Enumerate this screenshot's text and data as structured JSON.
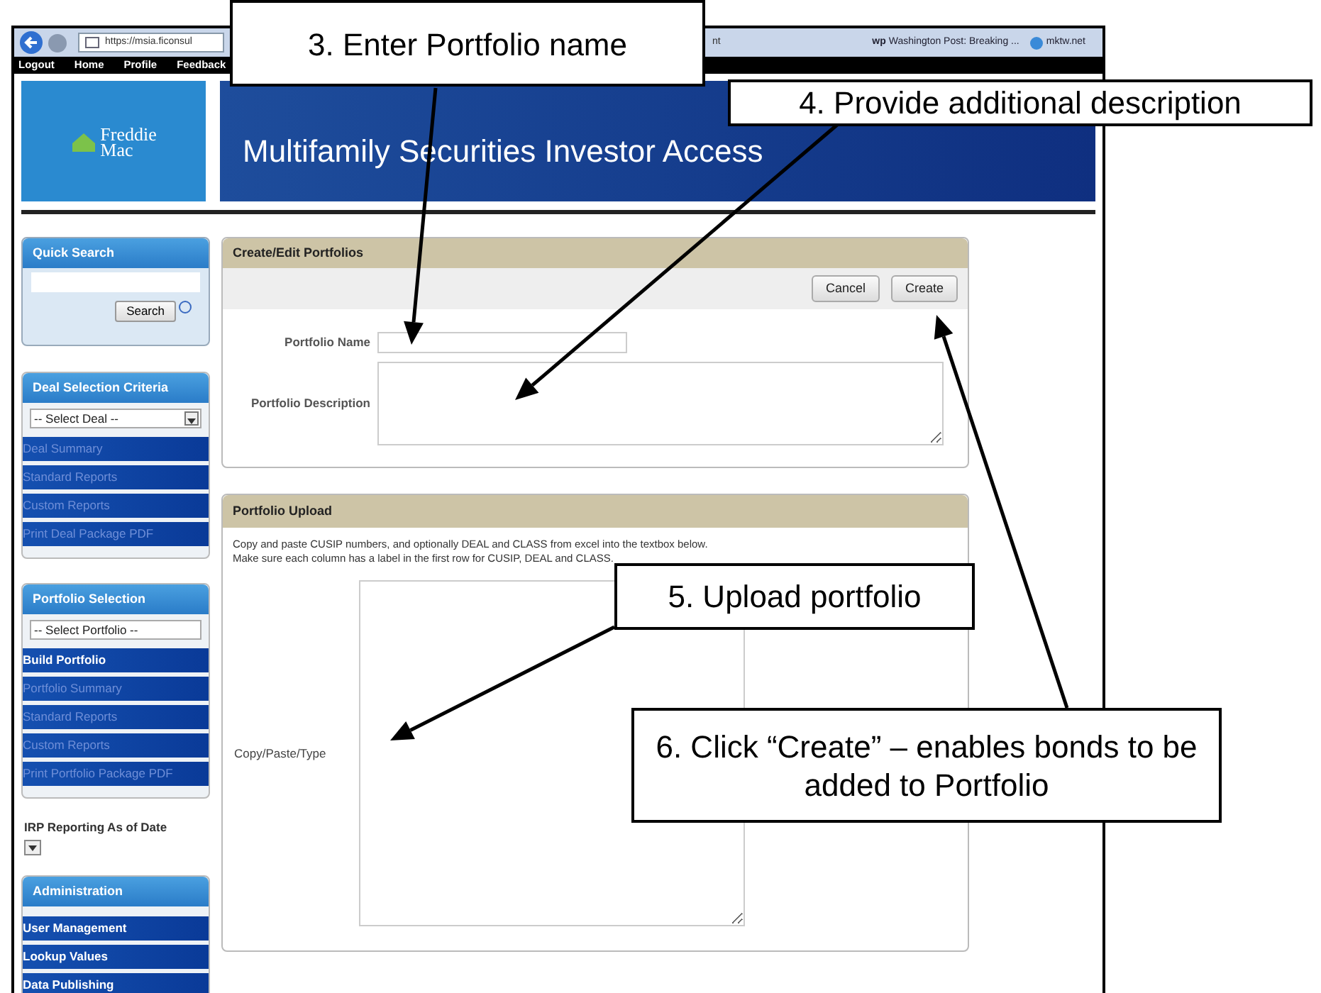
{
  "browser": {
    "address": "https://msia.ficonsul",
    "tab_fragment": "nt",
    "favorites": [
      {
        "label": "Washington Post: Breaking ...",
        "badge": "wp"
      },
      {
        "label": "mktw.net"
      }
    ]
  },
  "nav": [
    "Logout",
    "Home",
    "Profile",
    "Feedback"
  ],
  "logo": {
    "line_1": "Freddie",
    "line_2": "Mac"
  },
  "banner_title": "Multifamily Securities Investor Access",
  "sidebar": {
    "quick_search": {
      "title": "Quick Search",
      "button": "Search"
    },
    "sections": [
      {
        "title": "Deal Selection Criteria",
        "select": "-- Select Deal --",
        "items": [
          {
            "label": "Deal Summary",
            "disabled": true
          },
          {
            "label": "Standard Reports",
            "disabled": true
          },
          {
            "label": "Custom Reports",
            "disabled": true
          },
          {
            "label": "Print Deal Package PDF",
            "disabled": true
          }
        ]
      },
      {
        "title": "Portfolio Selection",
        "select": "-- Select Portfolio --",
        "items": [
          {
            "label": "Build Portfolio",
            "disabled": false
          },
          {
            "label": "Portfolio Summary",
            "disabled": true
          },
          {
            "label": "Standard Reports",
            "disabled": true
          },
          {
            "label": "Custom Reports",
            "disabled": true
          },
          {
            "label": "Print Portfolio Package PDF",
            "disabled": true
          }
        ]
      }
    ],
    "irp_label": "IRP Reporting As of Date",
    "administration": {
      "title": "Administration",
      "items": [
        {
          "label": "User Management",
          "disabled": false
        },
        {
          "label": "Lookup Values",
          "disabled": false
        },
        {
          "label": "Data Publishing",
          "disabled": false
        }
      ]
    }
  },
  "create_panel": {
    "title": "Create/Edit Portfolios",
    "buttons": [
      "Cancel",
      "Create"
    ],
    "fields": [
      {
        "label": "Portfolio Name",
        "kind": "input"
      },
      {
        "label": "Portfolio Description",
        "kind": "textarea"
      }
    ]
  },
  "upload_panel": {
    "title": "Portfolio Upload",
    "instructions": [
      "Copy and paste CUSIP numbers, and optionally DEAL and CLASS from excel into the textbox below.",
      "Make sure each column has a label in the first row for CUSIP, DEAL and CLASS."
    ],
    "field_label": "Copy/Paste/Type"
  },
  "callouts": [
    {
      "text": "3. Enter Portfolio name"
    },
    {
      "text": "4. Provide additional description"
    },
    {
      "text": "5. Upload portfolio"
    },
    {
      "text": "6. Click “Create” – enables bonds to be added to Portfolio"
    }
  ]
}
